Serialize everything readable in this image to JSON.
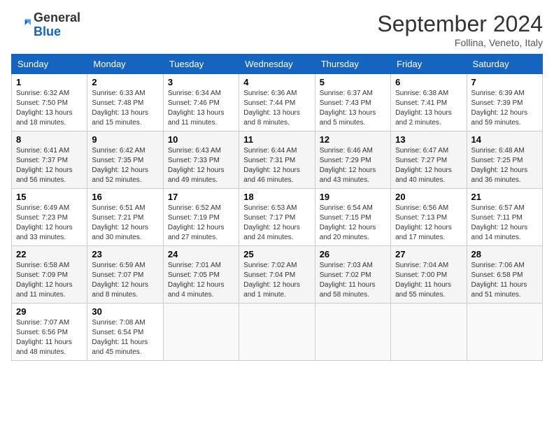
{
  "logo": {
    "general": "General",
    "blue": "Blue"
  },
  "header": {
    "month": "September 2024",
    "location": "Follina, Veneto, Italy"
  },
  "weekdays": [
    "Sunday",
    "Monday",
    "Tuesday",
    "Wednesday",
    "Thursday",
    "Friday",
    "Saturday"
  ],
  "weeks": [
    [
      {
        "day": "1",
        "sunrise": "6:32 AM",
        "sunset": "7:50 PM",
        "daylight": "13 hours and 18 minutes."
      },
      {
        "day": "2",
        "sunrise": "6:33 AM",
        "sunset": "7:48 PM",
        "daylight": "13 hours and 15 minutes."
      },
      {
        "day": "3",
        "sunrise": "6:34 AM",
        "sunset": "7:46 PM",
        "daylight": "13 hours and 11 minutes."
      },
      {
        "day": "4",
        "sunrise": "6:36 AM",
        "sunset": "7:44 PM",
        "daylight": "13 hours and 8 minutes."
      },
      {
        "day": "5",
        "sunrise": "6:37 AM",
        "sunset": "7:43 PM",
        "daylight": "13 hours and 5 minutes."
      },
      {
        "day": "6",
        "sunrise": "6:38 AM",
        "sunset": "7:41 PM",
        "daylight": "13 hours and 2 minutes."
      },
      {
        "day": "7",
        "sunrise": "6:39 AM",
        "sunset": "7:39 PM",
        "daylight": "12 hours and 59 minutes."
      }
    ],
    [
      {
        "day": "8",
        "sunrise": "6:41 AM",
        "sunset": "7:37 PM",
        "daylight": "12 hours and 56 minutes."
      },
      {
        "day": "9",
        "sunrise": "6:42 AM",
        "sunset": "7:35 PM",
        "daylight": "12 hours and 52 minutes."
      },
      {
        "day": "10",
        "sunrise": "6:43 AM",
        "sunset": "7:33 PM",
        "daylight": "12 hours and 49 minutes."
      },
      {
        "day": "11",
        "sunrise": "6:44 AM",
        "sunset": "7:31 PM",
        "daylight": "12 hours and 46 minutes."
      },
      {
        "day": "12",
        "sunrise": "6:46 AM",
        "sunset": "7:29 PM",
        "daylight": "12 hours and 43 minutes."
      },
      {
        "day": "13",
        "sunrise": "6:47 AM",
        "sunset": "7:27 PM",
        "daylight": "12 hours and 40 minutes."
      },
      {
        "day": "14",
        "sunrise": "6:48 AM",
        "sunset": "7:25 PM",
        "daylight": "12 hours and 36 minutes."
      }
    ],
    [
      {
        "day": "15",
        "sunrise": "6:49 AM",
        "sunset": "7:23 PM",
        "daylight": "12 hours and 33 minutes."
      },
      {
        "day": "16",
        "sunrise": "6:51 AM",
        "sunset": "7:21 PM",
        "daylight": "12 hours and 30 minutes."
      },
      {
        "day": "17",
        "sunrise": "6:52 AM",
        "sunset": "7:19 PM",
        "daylight": "12 hours and 27 minutes."
      },
      {
        "day": "18",
        "sunrise": "6:53 AM",
        "sunset": "7:17 PM",
        "daylight": "12 hours and 24 minutes."
      },
      {
        "day": "19",
        "sunrise": "6:54 AM",
        "sunset": "7:15 PM",
        "daylight": "12 hours and 20 minutes."
      },
      {
        "day": "20",
        "sunrise": "6:56 AM",
        "sunset": "7:13 PM",
        "daylight": "12 hours and 17 minutes."
      },
      {
        "day": "21",
        "sunrise": "6:57 AM",
        "sunset": "7:11 PM",
        "daylight": "12 hours and 14 minutes."
      }
    ],
    [
      {
        "day": "22",
        "sunrise": "6:58 AM",
        "sunset": "7:09 PM",
        "daylight": "12 hours and 11 minutes."
      },
      {
        "day": "23",
        "sunrise": "6:59 AM",
        "sunset": "7:07 PM",
        "daylight": "12 hours and 8 minutes."
      },
      {
        "day": "24",
        "sunrise": "7:01 AM",
        "sunset": "7:05 PM",
        "daylight": "12 hours and 4 minutes."
      },
      {
        "day": "25",
        "sunrise": "7:02 AM",
        "sunset": "7:04 PM",
        "daylight": "12 hours and 1 minute."
      },
      {
        "day": "26",
        "sunrise": "7:03 AM",
        "sunset": "7:02 PM",
        "daylight": "11 hours and 58 minutes."
      },
      {
        "day": "27",
        "sunrise": "7:04 AM",
        "sunset": "7:00 PM",
        "daylight": "11 hours and 55 minutes."
      },
      {
        "day": "28",
        "sunrise": "7:06 AM",
        "sunset": "6:58 PM",
        "daylight": "11 hours and 51 minutes."
      }
    ],
    [
      {
        "day": "29",
        "sunrise": "7:07 AM",
        "sunset": "6:56 PM",
        "daylight": "11 hours and 48 minutes."
      },
      {
        "day": "30",
        "sunrise": "7:08 AM",
        "sunset": "6:54 PM",
        "daylight": "11 hours and 45 minutes."
      },
      null,
      null,
      null,
      null,
      null
    ]
  ]
}
